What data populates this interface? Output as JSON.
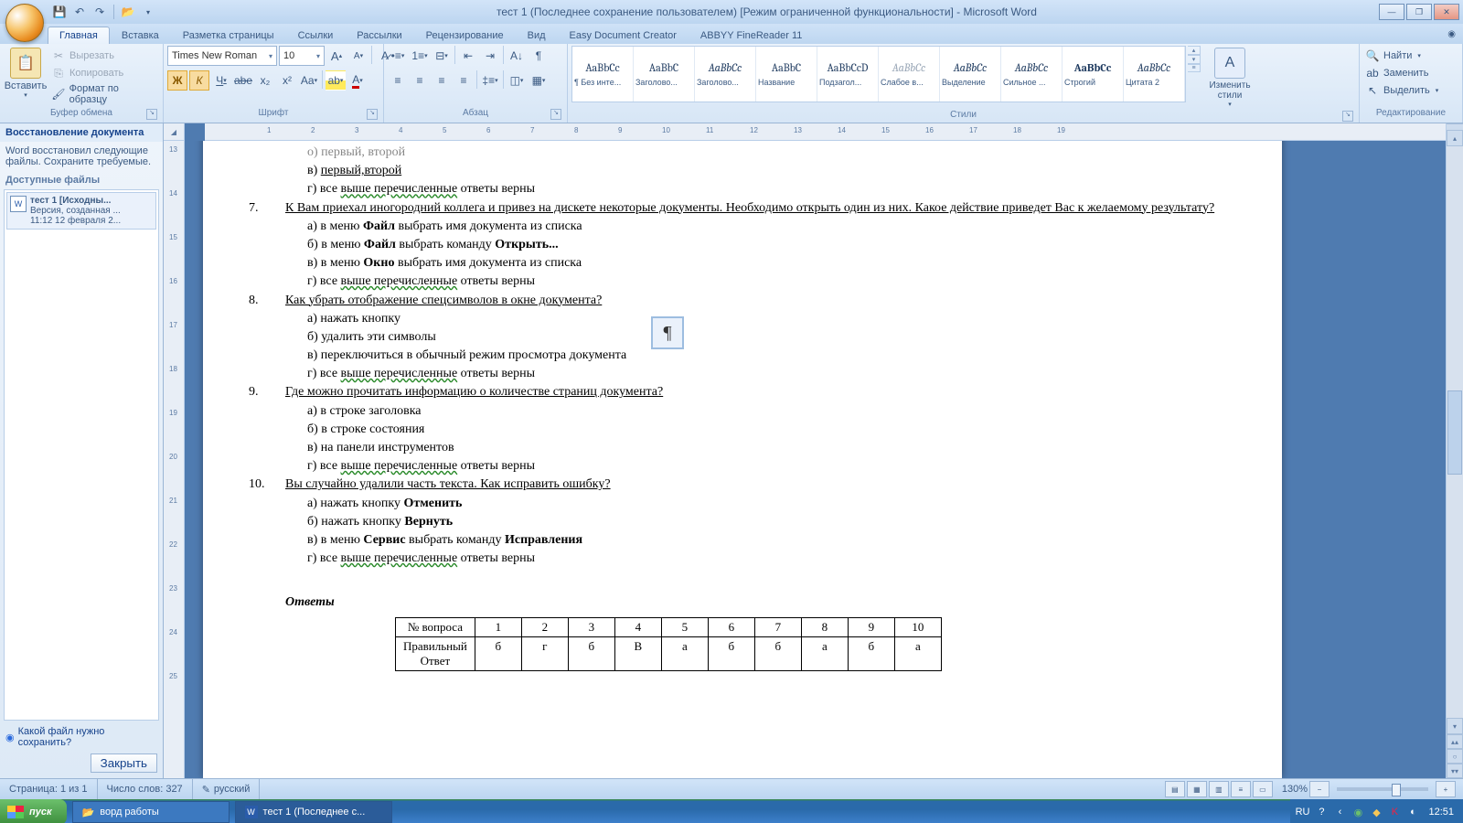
{
  "title": "тест 1 (Последнее сохранение пользователем) [Режим ограниченной функциональности] - Microsoft Word",
  "tabs": [
    "Главная",
    "Вставка",
    "Разметка страницы",
    "Ссылки",
    "Рассылки",
    "Рецензирование",
    "Вид",
    "Easy Document Creator",
    "ABBYY FineReader 11"
  ],
  "activeTab": 0,
  "clipboard": {
    "label": "Буфер обмена",
    "paste": "Вставить",
    "cut": "Вырезать",
    "copy": "Копировать",
    "fmt": "Формат по образцу"
  },
  "font": {
    "label": "Шрифт",
    "name": "Times New Roman",
    "size": "10"
  },
  "para": {
    "label": "Абзац"
  },
  "stylesLabel": "Стили",
  "styles": [
    {
      "prev": "AaBbCc",
      "lbl": "¶ Без инте..."
    },
    {
      "prev": "AaBbC",
      "lbl": "Заголово..."
    },
    {
      "prev": "AaBbCc",
      "lbl": "Заголово...",
      "i": true
    },
    {
      "prev": "AaBbC",
      "lbl": "Название"
    },
    {
      "prev": "AaBbCcD",
      "lbl": "Подзагол..."
    },
    {
      "prev": "AaBbCc",
      "lbl": "Слабое в...",
      "faded": true,
      "i": true
    },
    {
      "prev": "AaBbCc",
      "lbl": "Выделение",
      "i": true
    },
    {
      "prev": "AaBbCc",
      "lbl": "Сильное ...",
      "i": true
    },
    {
      "prev": "AaBbCc",
      "lbl": "Строгий",
      "b": true
    },
    {
      "prev": "AaBbCc",
      "lbl": "Цитата 2",
      "i": true
    }
  ],
  "changeStyles": "Изменить стили",
  "editing": {
    "label": "Редактирование",
    "find": "Найти",
    "replace": "Заменить",
    "select": "Выделить"
  },
  "recovery": {
    "title": "Восстановление документа",
    "msg": "Word восстановил следующие файлы. Сохраните требуемые.",
    "avail": "Доступные файлы",
    "file": {
      "name": "тест 1  [Исходны...",
      "ver": "Версия, созданная ...",
      "time": "11:12 12 февраля 2..."
    },
    "help": "Какой файл нужно сохранить?",
    "close": "Закрыть"
  },
  "document": {
    "l_b0": "о) первый, второй",
    "l_v0": "в) ",
    "l_v0_u": "первый,второй",
    "l_g0": "г) все ",
    "l_g0_w": "выше перечисленные",
    "l_g0_r": " ответы верны",
    "q7n": "7.",
    "q7": "К Вам приехал иногородний коллега и привез на дискете некоторые документы. Необходимо открыть один из них. Какое действие приведет Вас к желаемому результату?",
    "q7a": "а) в меню ",
    "q7a_b": "Файл",
    "q7a_r": " выбрать имя документа из списка",
    "q7b": "б) в меню ",
    "q7b_b": "Файл",
    "q7b_r": " выбрать команду ",
    "q7b_b2": "Открыть...",
    "q7c": "в) в меню ",
    "q7c_b": "Окно",
    "q7c_r": " выбрать имя документа из списка",
    "q7d": "г) все ",
    "q7d_w": "выше перечисленные",
    "q7d_r": " ответы верны",
    "q8n": "8.",
    "q8": "Как убрать отображение спецсимволов в окне документа?",
    "q8a": "а) нажать кнопку",
    "q8b": "б) удалить эти символы",
    "q8c": "в) переключиться в обычный режим просмотра документа",
    "q8d": "г) все ",
    "q8d_w": "выше перечисленные",
    "q8d_r": " ответы верны",
    "q9n": "9.",
    "q9": "Где можно прочитать информацию о количестве страниц документа?",
    "q9a": "а) в строке заголовка",
    "q9b": "б) в строке состояния",
    "q9c": "в) на панели инструментов",
    "q9d": "г) все ",
    "q9d_w": "выше перечисленные",
    "q9d_r": " ответы верны",
    "q10n": "10.",
    "q10": "Вы случайно удалили часть текста. Как исправить ошибку?",
    "q10a": "а) нажать кнопку ",
    "q10a_b": "Отменить",
    "q10b": "б) нажать кнопку ",
    "q10b_b": "Вернуть",
    "q10c": "в) в меню ",
    "q10c_b": "Сервис",
    "q10c_r": " выбрать команду ",
    "q10c_b2": "Исправления",
    "q10d": "г) все ",
    "q10d_w": "выше перечисленные",
    "q10d_r": " ответы верны",
    "answers_title": "Ответы",
    "table": {
      "h": "№ вопроса",
      "r": "Правильный Ответ",
      "nums": [
        "1",
        "2",
        "3",
        "4",
        "5",
        "6",
        "7",
        "8",
        "9",
        "10"
      ],
      "ans": [
        "б",
        "г",
        "б",
        "В",
        "а",
        "б",
        "б",
        "а",
        "б",
        "а"
      ]
    }
  },
  "status": {
    "page": "Страница: 1 из 1",
    "words": "Число слов: 327",
    "lang": "русский",
    "zoom": "130%"
  },
  "taskbar": {
    "start": "пуск",
    "t1": "ворд работы",
    "t2": "тест 1 (Последнее с...",
    "lang": "RU",
    "clock": "12:51"
  }
}
